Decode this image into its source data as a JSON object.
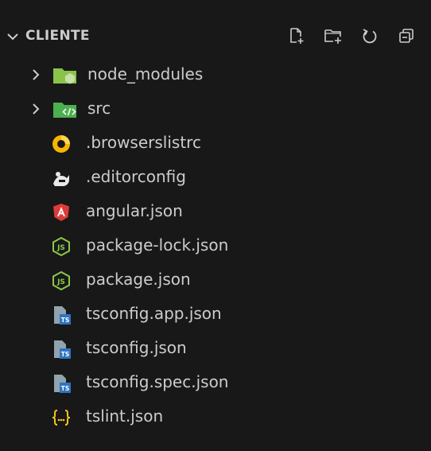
{
  "explorer": {
    "title": "CLIENTE",
    "actions": [
      "new-file",
      "new-folder",
      "refresh",
      "collapse-all"
    ]
  },
  "tree": {
    "folders": [
      {
        "label": "node_modules"
      },
      {
        "label": "src"
      }
    ],
    "files": [
      {
        "label": ".browserslistrc"
      },
      {
        "label": ".editorconfig"
      },
      {
        "label": "angular.json"
      },
      {
        "label": "package-lock.json"
      },
      {
        "label": "package.json"
      },
      {
        "label": "tsconfig.app.json"
      },
      {
        "label": "tsconfig.json"
      },
      {
        "label": "tsconfig.spec.json"
      },
      {
        "label": "tslint.json"
      }
    ]
  },
  "colors": {
    "background": "#181818",
    "text": "#cccccc",
    "folder_green": "#8bc34a",
    "angular_red": "#dd3b3b",
    "node_green": "#8cc84b",
    "ts_blue": "#2f74c0",
    "json_yellow": "#f5c518",
    "browsers_orange": "#f7b500"
  }
}
